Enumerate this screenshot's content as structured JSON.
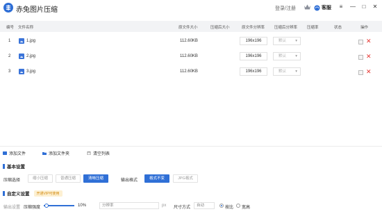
{
  "app": {
    "title": "赤兔图片压缩",
    "login": "登录/注册",
    "service": "客服",
    "brand_color": "#2f6fd6"
  },
  "window_controls": {
    "menu": "≡",
    "minimize": "—",
    "maximize": "□",
    "close": "✕"
  },
  "table": {
    "headers": {
      "index": "编号",
      "name": "文件名称",
      "orig_size": "原文件大小",
      "comp_size": "压缩后大小",
      "orig_res": "原文件分辨率",
      "comp_res": "压缩后分辨率",
      "ratio": "压缩率",
      "status": "状态",
      "action": "操作"
    },
    "rows": [
      {
        "index": "1",
        "name": "1.jpg",
        "size": "112.60KB",
        "res": "196x196",
        "target_res": "默认"
      },
      {
        "index": "2",
        "name": "2.jpg",
        "size": "112.60KB",
        "res": "196x196",
        "target_res": "默认"
      },
      {
        "index": "3",
        "name": "3.jpg",
        "size": "112.60KB",
        "res": "196x196",
        "target_res": "默认"
      }
    ]
  },
  "toolbar": {
    "add_file": "添加文件",
    "add_folder": "添加文件夹",
    "clear_list": "清空列表"
  },
  "basic": {
    "section_title": "基本设置",
    "mode_label": "压缩选择",
    "modes": [
      "缩小压缩",
      "普通压缩",
      "清晰压缩"
    ],
    "active_mode": "清晰压缩",
    "format_label": "输出格式",
    "formats": [
      "格式不变",
      "JPG格式"
    ],
    "active_format": "格式不变"
  },
  "advanced": {
    "section_title": "自定义设置",
    "vip_badge": "开通VIP可使用",
    "quality_label": "输出设置",
    "quality_value": "压缩强度",
    "quality_percent": 10,
    "percent_suffix": "%",
    "size_placeholder": "分辨率",
    "px_suffix": "px",
    "mode_label": "尺寸方式",
    "mode_value": "自动",
    "radio_options": [
      "按比",
      "宽高"
    ],
    "radio_selected": "按比"
  }
}
